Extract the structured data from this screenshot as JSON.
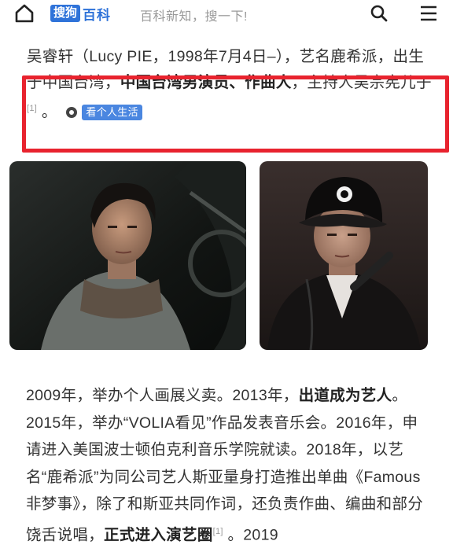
{
  "header": {
    "logo_box": "搜狗",
    "logo_text": "百科",
    "search_placeholder": "百科新知，搜一下!",
    "icons": [
      "home-icon",
      "search-icon",
      "menu-icon"
    ]
  },
  "intro": {
    "line1": "吴睿轩（Lucy PIE，1998年7月4日–），艺名鹿希派，",
    "part2_pre": "出生于中国台湾，",
    "part2_bold": "中国台湾男演员、作曲人",
    "part2_post": "，主持人吴宗宪儿子",
    "cite": "[1]",
    "tail": "。",
    "life_button": "看个人生活"
  },
  "photos": [
    "photo-left",
    "photo-right"
  ],
  "body": {
    "s1": "2009年，举办个人画展义卖。2013年，",
    "s1_bold": "出道成为艺人",
    "s2": "。2015年，举办“VOLIA看见”作品发表音乐会。2016年，申请进入美国波士顿伯克利音乐学院就读。2018年，以艺名“鹿希派”为同公司艺人斯亚量身打造推出单曲《Famous非梦事》，除了和斯亚共同作词，还负责作曲、编曲和部分饶舌说唱，",
    "s2_bold": "正式进入演艺圈",
    "cite": "[1]",
    "s3": "。2019"
  },
  "colors": {
    "brand": "#2f73d9",
    "highlight": "#e8232e",
    "button": "#4a86e0"
  }
}
